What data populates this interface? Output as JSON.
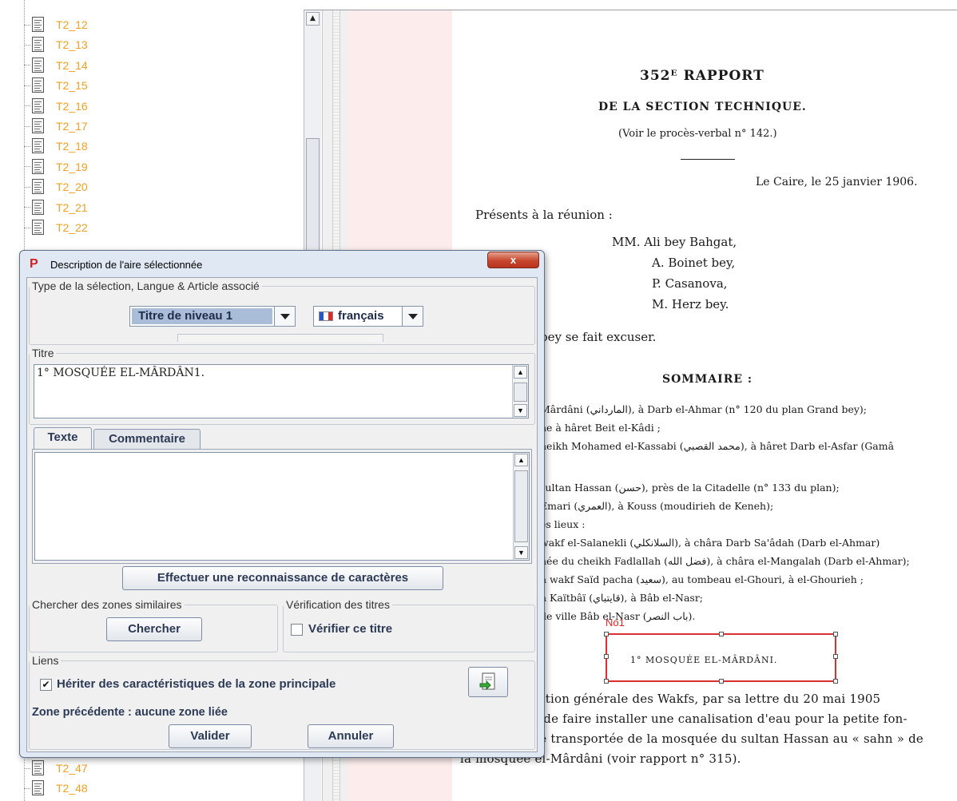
{
  "tree": {
    "items_top": [
      "T2_12",
      "T2_13",
      "T2_14",
      "T2_15",
      "T2_16",
      "T2_17",
      "T2_18",
      "T2_19",
      "T2_20",
      "T2_21",
      "T2_22"
    ],
    "items_bottom": [
      "T2_47",
      "T2_48"
    ]
  },
  "document": {
    "title": "352ᴱ RAPPORT",
    "subtitle": "DE LA SECTION TECHNIQUE.",
    "ref": "(Voir le procès-verbal n° 142.)",
    "place_date": "Le Caire, le 25 janvier 1906.",
    "presents": "Présents à la réunion :",
    "members": [
      "MM. Ali bey Bahgat,",
      "A. Boinet bey,",
      "P. Casanova,",
      "M. Herz bey."
    ],
    "excuse": "bey se fait excuser.",
    "sommaire": "SOMMAIRE :",
    "summary_lines": [
      "Mârdâni (المارداني), à Darb el-Ahmar (n° 120 du plan Grand bey);",
      "ne à hâret Beit el-Kâdi ;",
      "heikh Mohamed el-Kassabi (محمد القصبي), à hâret Darb el-Asfar (Gamâ",
      "",
      "sultan Hassan (حسن), près de la Citadelle (n° 133 du plan);",
      "Emari (العمري), à Kouss (moudirieh de Keneh);",
      "es lieux :",
      "wakf el-Salanekli (السلانكلي), à châra Darb Sa'âdah (Darb el-Ahmar)",
      "née du cheikh Fadlallah (فضل الله), à châra el-Mangalah (Darb el-Ahmar);",
      "n wakf Saïd pacha (سعيد), au tombeau el-Ghouri, à el-Ghourieh ;",
      "h Kaïtbâï (قايتباي), à Bâb el-Nasr;",
      "de ville Bâb el-Nasr (باب النصر)."
    ],
    "selection_label": "No1",
    "selection_text": "1° MOSQUÉE EL-MÂRDÂNI.",
    "body_lines": [
      "tration générale des Wakfs, par sa lettre du 20 mai 1905",
      "té de faire installer une canalisation d'eau pour la petite fon-",
      "été transportée de la mosquée du sultan Hassan au « sahn » de",
      "la mosquée el-Mârdâni (voir rapport n° 315)."
    ]
  },
  "dialog": {
    "title": "Description de l'aire sélectionnée",
    "close_label": "x",
    "section_type_label": "Type de la sélection, Langue & Article associé",
    "type_value": "Titre de niveau 1",
    "language_value": "français",
    "flag_colors": [
      "#2a55c8",
      "#ffffff",
      "#e02828"
    ],
    "titre_label": "Titre",
    "titre_value": "1° MOSQUÉE EL-MÂRDÂN1.",
    "tab_texte": "Texte",
    "tab_commentaire": "Commentaire",
    "ocr_button": "Effectuer une reconnaissance de caractères",
    "similar_label": "Chercher des zones similaires",
    "search_button": "Chercher",
    "verif_label": "Vérification des titres",
    "verif_checkbox_label": "Vérifier ce titre",
    "verif_checked": false,
    "liens_label": "Liens",
    "inherit_label": "Hériter des caractéristiques de la zone principale",
    "inherit_checked": true,
    "zone_prev": "Zone précédente : aucune zone liée",
    "validate_button": "Valider",
    "cancel_button": "Annuler"
  }
}
